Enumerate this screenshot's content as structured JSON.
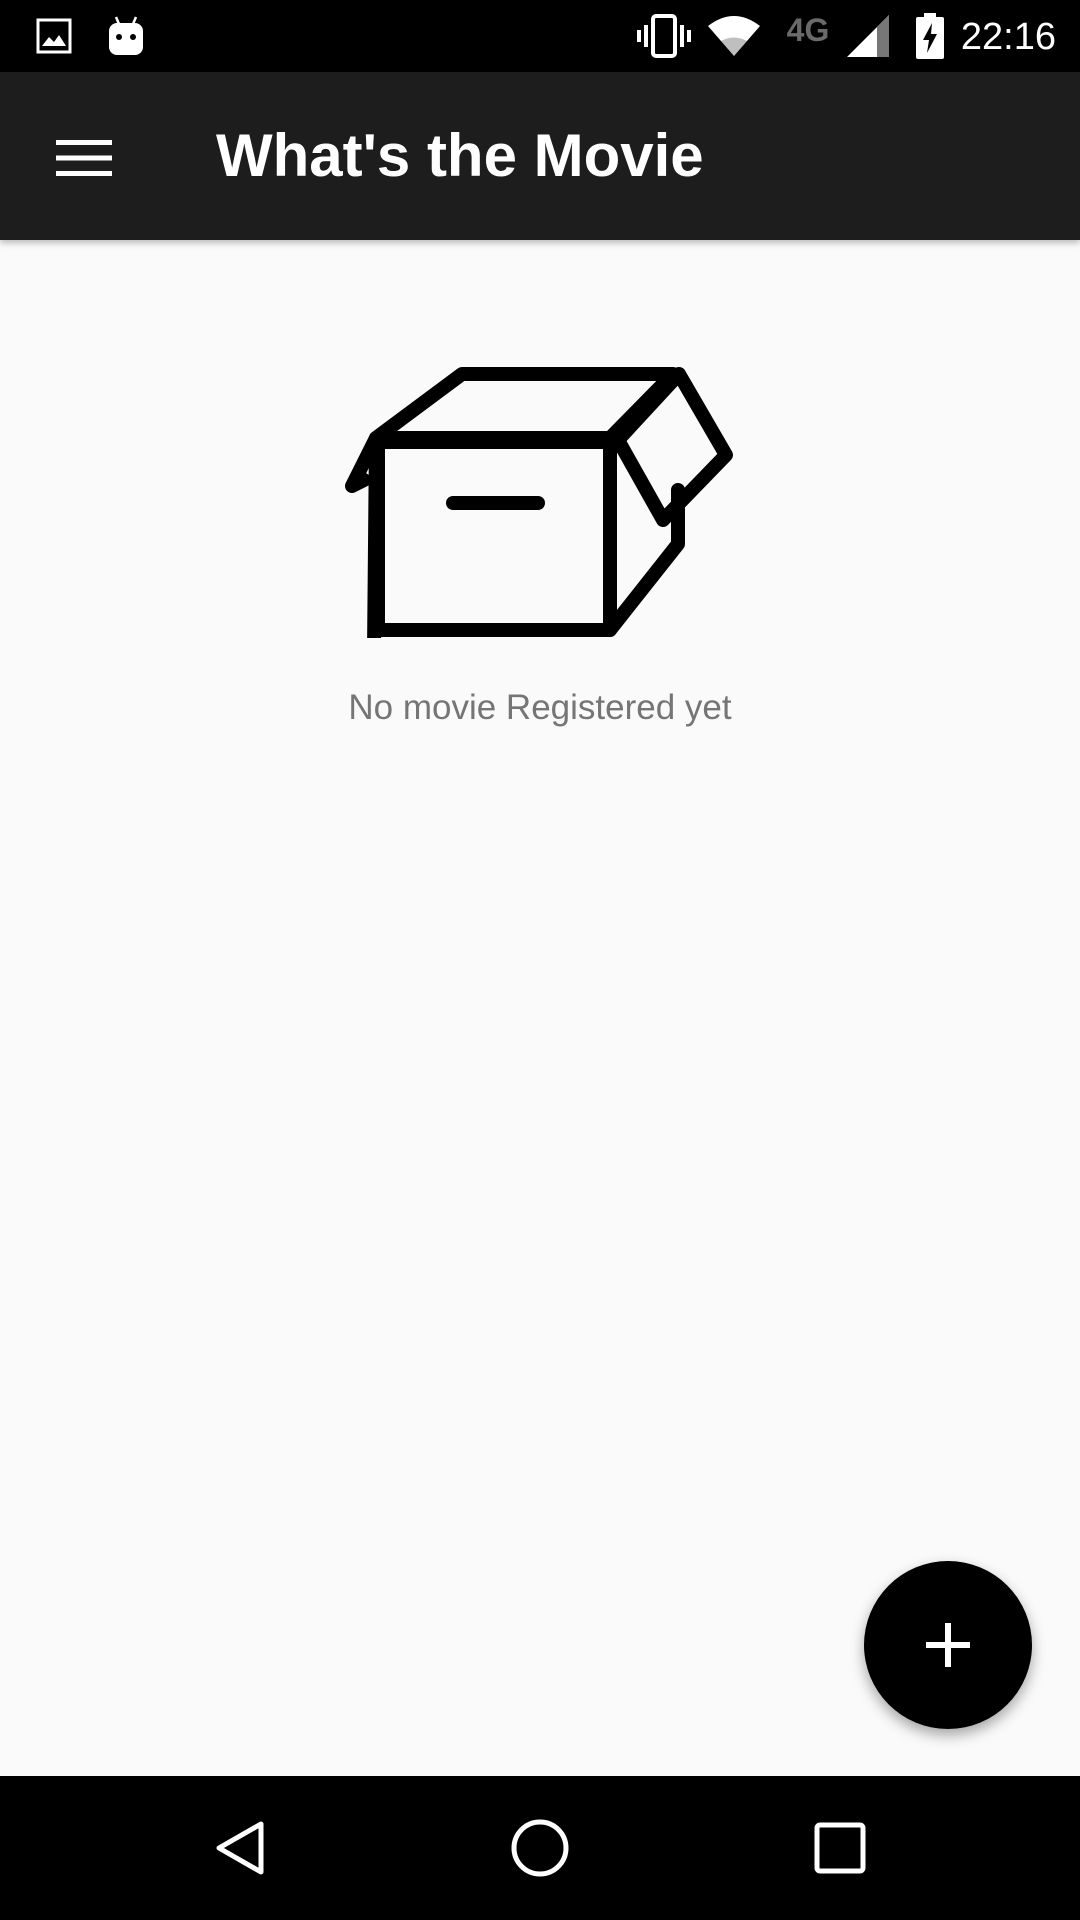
{
  "status_bar": {
    "time": "22:16",
    "network_label": "4G",
    "icons": [
      "image-notification-icon",
      "android-notification-icon",
      "vibrate-icon",
      "wifi-icon",
      "signal-icon",
      "battery-charging-icon"
    ]
  },
  "app_bar": {
    "menu_icon": "hamburger-menu-icon",
    "title": "What's the Movie"
  },
  "empty_state": {
    "icon": "open-box-icon",
    "message": "No movie Registered yet"
  },
  "fab": {
    "icon": "plus-icon"
  },
  "nav_bar": {
    "back_icon": "back-triangle-icon",
    "home_icon": "home-circle-icon",
    "recents_icon": "recents-square-icon"
  },
  "colors": {
    "status_bar": "#000000",
    "app_bar": "#1d1d1d",
    "background": "#fafafa",
    "message_text": "#757575",
    "fab": "#000000",
    "nav_bar": "#000000"
  }
}
